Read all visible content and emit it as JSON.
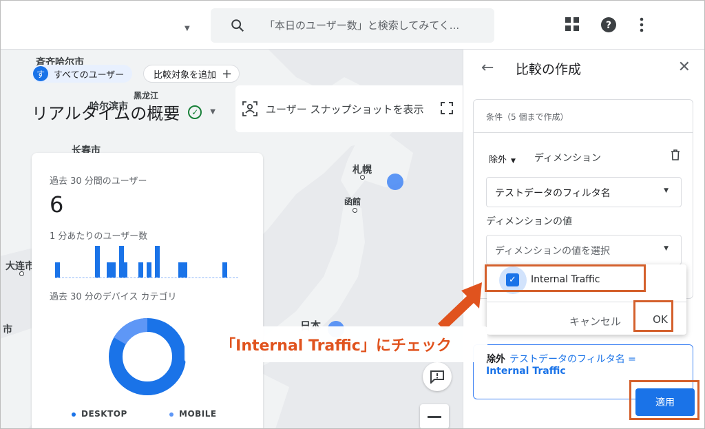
{
  "search": {
    "placeholder": "「本日のユーザー数」と検索してみてく..."
  },
  "map": {
    "cities": [
      "斉齐哈尔市",
      "哈尔滨市",
      "黑龙江",
      "长春市",
      "札幌",
      "函館",
      "大连市",
      "日本",
      "市"
    ],
    "chips": {
      "all_users": "すべてのユーザー",
      "avatar_letter": "す",
      "add_comparison": "比較対象を追加"
    },
    "title": "リアルタイムの概要",
    "snapshot_label": "ユーザー スナップショットを表示"
  },
  "card": {
    "users_label": "過去 30 分間のユーザー",
    "users_value": "6",
    "per_minute_label": "1 分あたりのユーザー数",
    "per_minute_bars": [
      1,
      0,
      0,
      0,
      0,
      0,
      0,
      0,
      0,
      0,
      1,
      0,
      0,
      1,
      1,
      0,
      1,
      1,
      0,
      0,
      0,
      1,
      0,
      1,
      0,
      1,
      0,
      0,
      0,
      0,
      0,
      1,
      1,
      0,
      0,
      0,
      0,
      0,
      0,
      0,
      0,
      0,
      1,
      0,
      0,
      0
    ],
    "device_label": "過去 30 分のデバイス カテゴリ",
    "legend": [
      {
        "name": "DESKTOP",
        "color": "#1a73e8"
      },
      {
        "name": "MOBILE",
        "color": "#5e97f6"
      }
    ]
  },
  "panel": {
    "title": "比較の作成",
    "condition_header": "条件（5 個まで作成）",
    "exclude": "除外",
    "dimension_label": "ディメンション",
    "dimension_select": "テストデータのフィルタ名",
    "value_label": "ディメンションの値",
    "value_placeholder": "ディメンションの値を選択",
    "option": "Internal Traffic",
    "cancel": "キャンセル",
    "ok": "OK",
    "summary_prefix": "除外",
    "summary_dim": "テストデータのフィルタ名 =",
    "summary_value": "Internal Traffic",
    "apply": "適用"
  },
  "annotation": {
    "callout": "「Internal Traffic」にチェック",
    "color": "#d4602c"
  }
}
